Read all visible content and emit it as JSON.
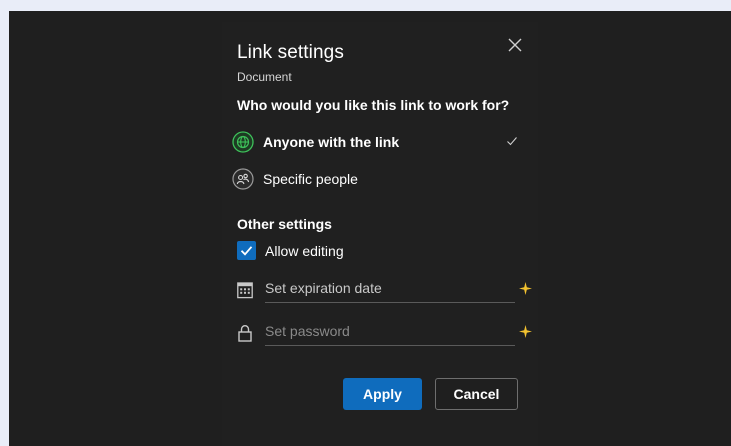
{
  "dialog": {
    "title": "Link settings",
    "subtitle": "Document",
    "question": "Who would you like this link to work for?",
    "options": [
      {
        "label": "Anyone with the link",
        "icon": "globe-icon",
        "selected": true
      },
      {
        "label": "Specific people",
        "icon": "people-icon",
        "selected": false
      }
    ],
    "other_settings": {
      "heading": "Other settings",
      "allow_editing": {
        "label": "Allow editing",
        "checked": true
      },
      "expiration": {
        "placeholder": "Set expiration date",
        "icon": "calendar-icon"
      },
      "password": {
        "placeholder": "Set password",
        "icon": "lock-icon"
      }
    },
    "buttons": {
      "apply": "Apply",
      "cancel": "Cancel"
    }
  },
  "colors": {
    "accent": "#0f6cbd",
    "globe_green": "#3ec15a",
    "premium_star": "#f2c230",
    "dialog_bg": "#202020",
    "page_bg": "#e9edf8"
  }
}
